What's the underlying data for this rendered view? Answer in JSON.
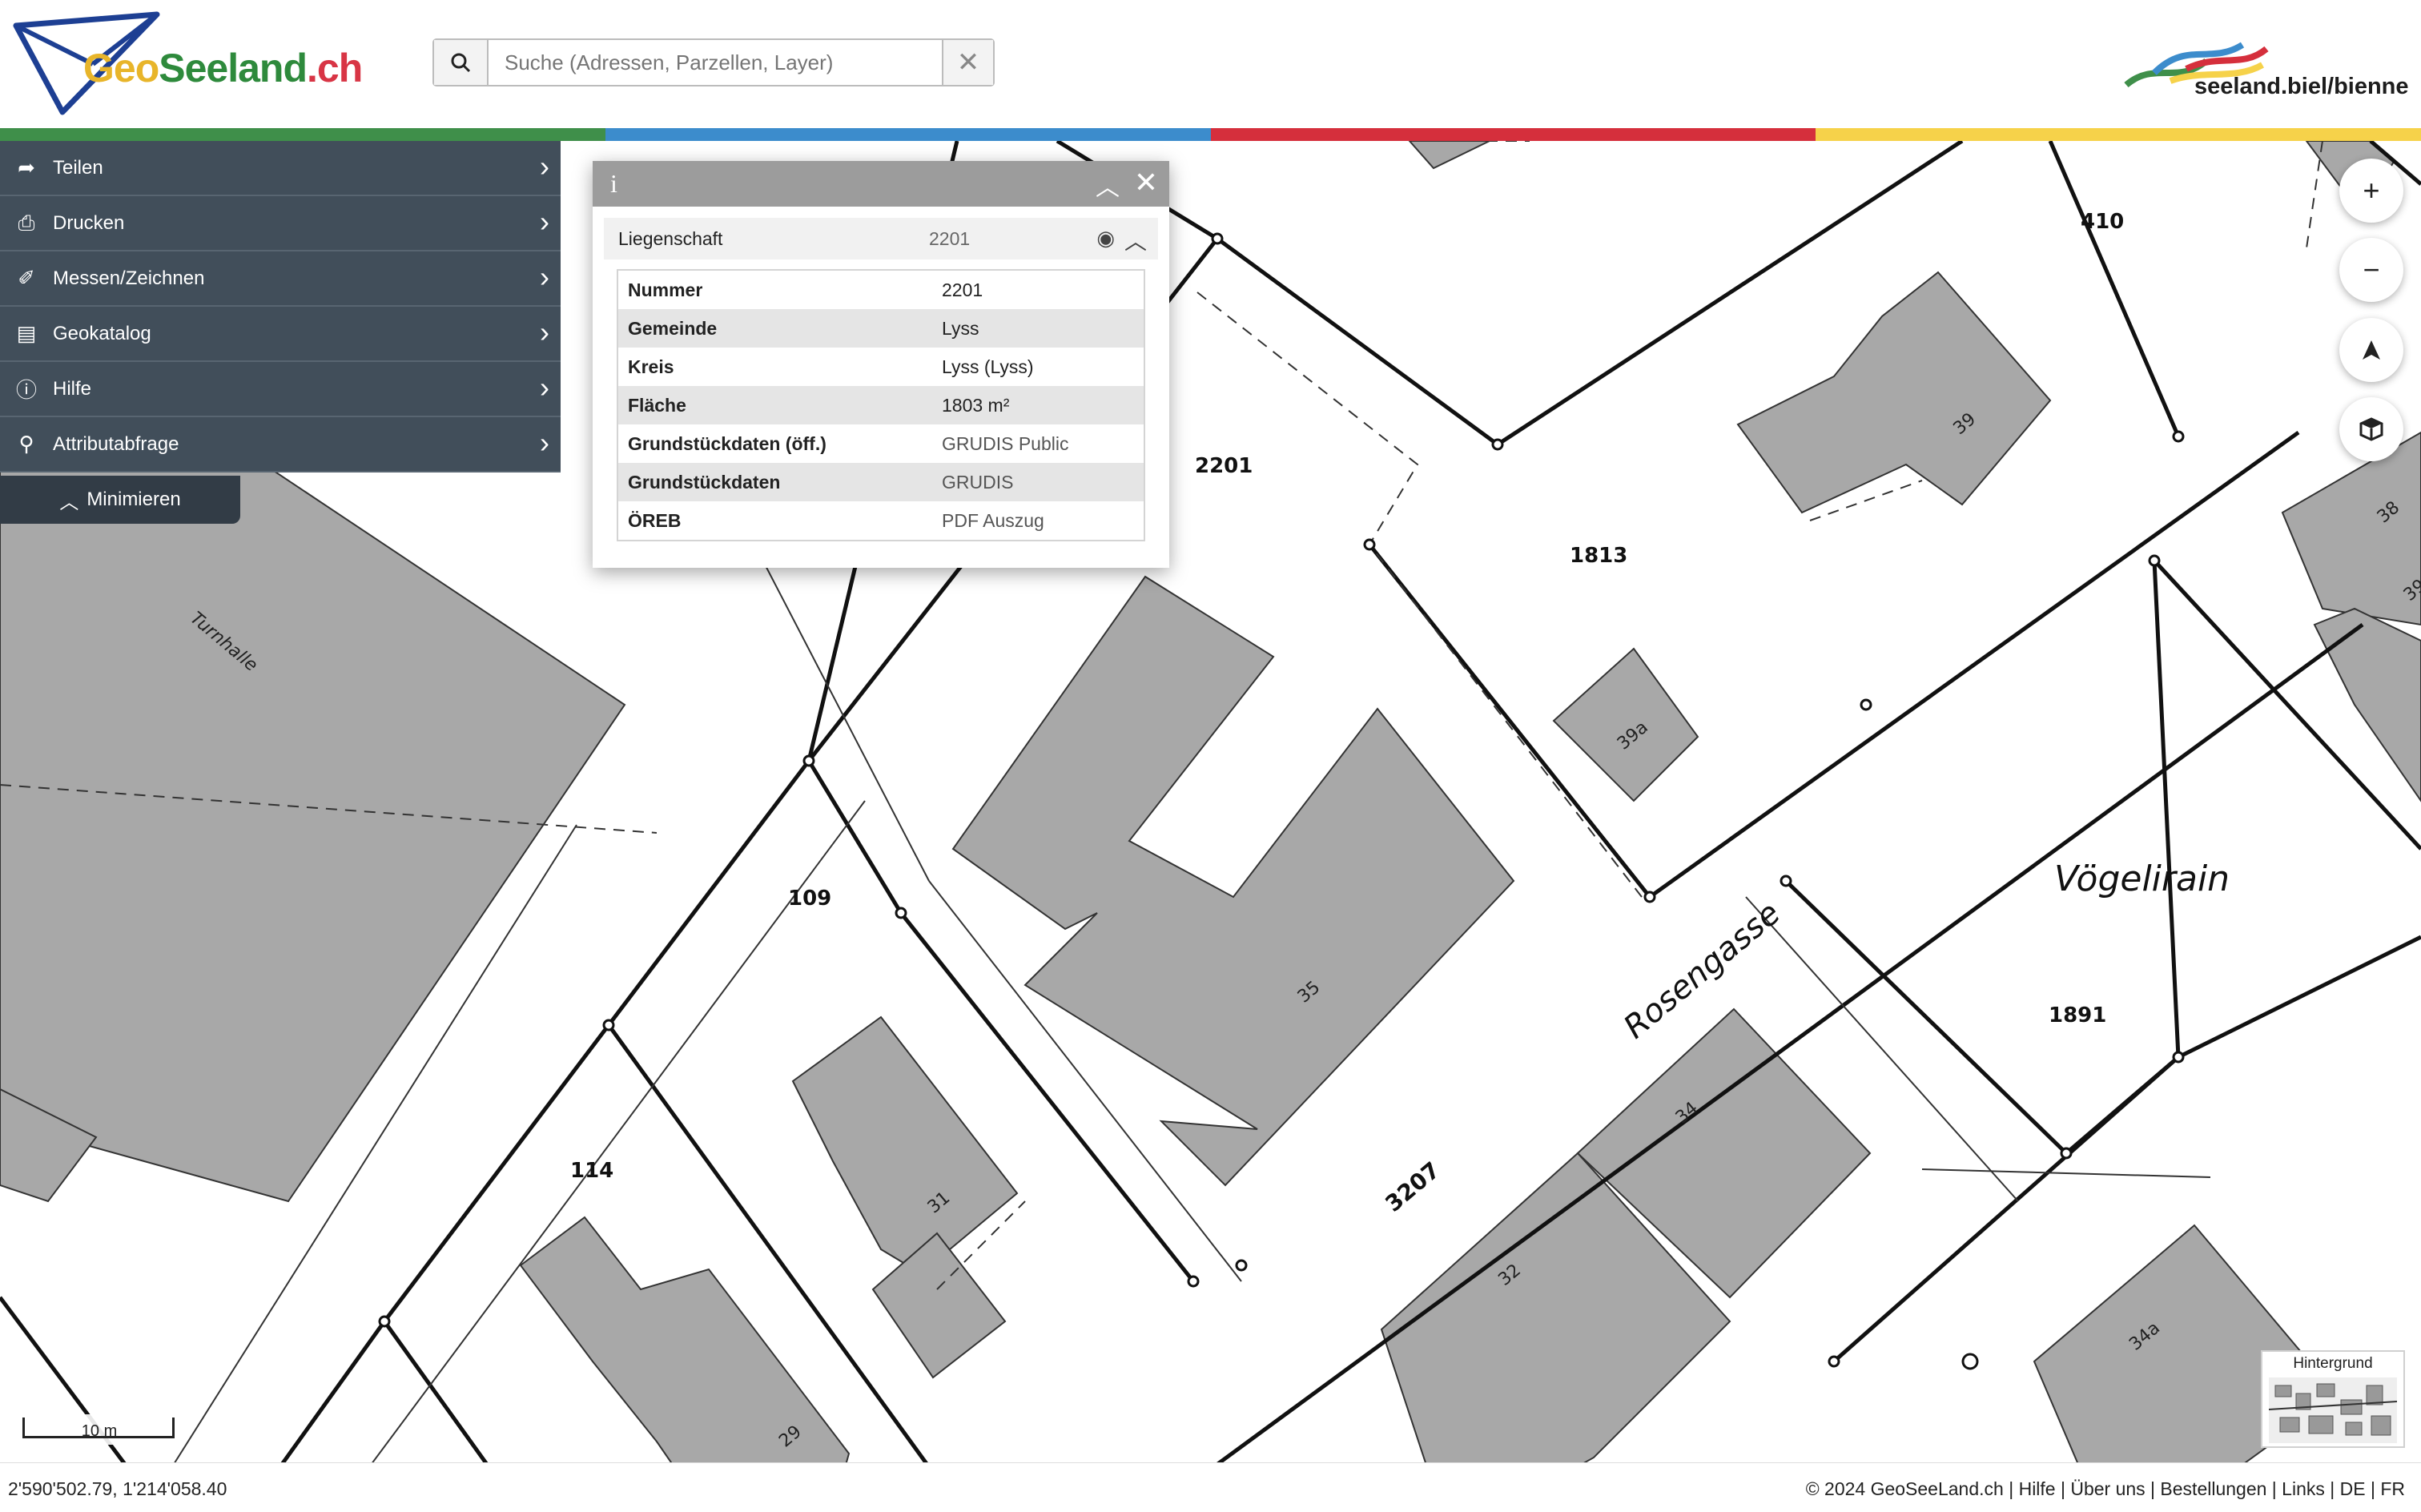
{
  "header": {
    "brand": {
      "part1": "G",
      "part2": "eo",
      "part3": "Seeland",
      "part4": ".ch"
    },
    "search_placeholder": "Suche (Adressen, Parzellen, Layer)",
    "region_logo_text": "seeland.biel/bienne",
    "colorbar": [
      "#3f8f4a",
      "#3c8ccc",
      "#d52f3c",
      "#f6d24a"
    ]
  },
  "menu": {
    "items": [
      {
        "label": "Teilen",
        "icon": "share-icon"
      },
      {
        "label": "Drucken",
        "icon": "print-icon"
      },
      {
        "label": "Messen/Zeichnen",
        "icon": "measure-icon"
      },
      {
        "label": "Geokatalog",
        "icon": "map-catalog-icon"
      },
      {
        "label": "Hilfe",
        "icon": "info-icon"
      },
      {
        "label": "Attributabfrage",
        "icon": "search-icon"
      }
    ],
    "minimize_label": "Minimieren"
  },
  "info_panel": {
    "header_icon": "i",
    "section": {
      "title": "Liegenschaft",
      "value": "2201"
    },
    "rows": [
      {
        "key": "Nummer",
        "value": "2201"
      },
      {
        "key": "Gemeinde",
        "value": "Lyss"
      },
      {
        "key": "Kreis",
        "value": "Lyss (Lyss)"
      },
      {
        "key": "Fläche",
        "value": "1803 m²"
      },
      {
        "key": "Grundstückdaten (öff.)",
        "value": "GRUDIS Public"
      },
      {
        "key": "Grundstückdaten",
        "value": "GRUDIS"
      },
      {
        "key": "ÖREB",
        "value": "PDF Auszug"
      }
    ]
  },
  "map_labels": {
    "parcels": [
      "410",
      "2201",
      "1813",
      "109",
      "114",
      "1891"
    ],
    "buildings": [
      "39",
      "39a",
      "35",
      "31",
      "29",
      "34",
      "32",
      "34a",
      "38",
      "39"
    ],
    "streets": [
      "Rosengasse",
      "3207",
      "Vögelirain"
    ],
    "special": [
      "Turnhalle"
    ]
  },
  "controls": {
    "zoom_in": "+",
    "zoom_out": "−",
    "background_label": "Hintergrund"
  },
  "scale": {
    "label": "10 m"
  },
  "footer": {
    "coordinates": "2'590'502.79, 1'214'058.40",
    "links": "© 2024 GeoSeeLand.ch | Hilfe | Über uns | Bestellungen | Links | DE | FR"
  }
}
